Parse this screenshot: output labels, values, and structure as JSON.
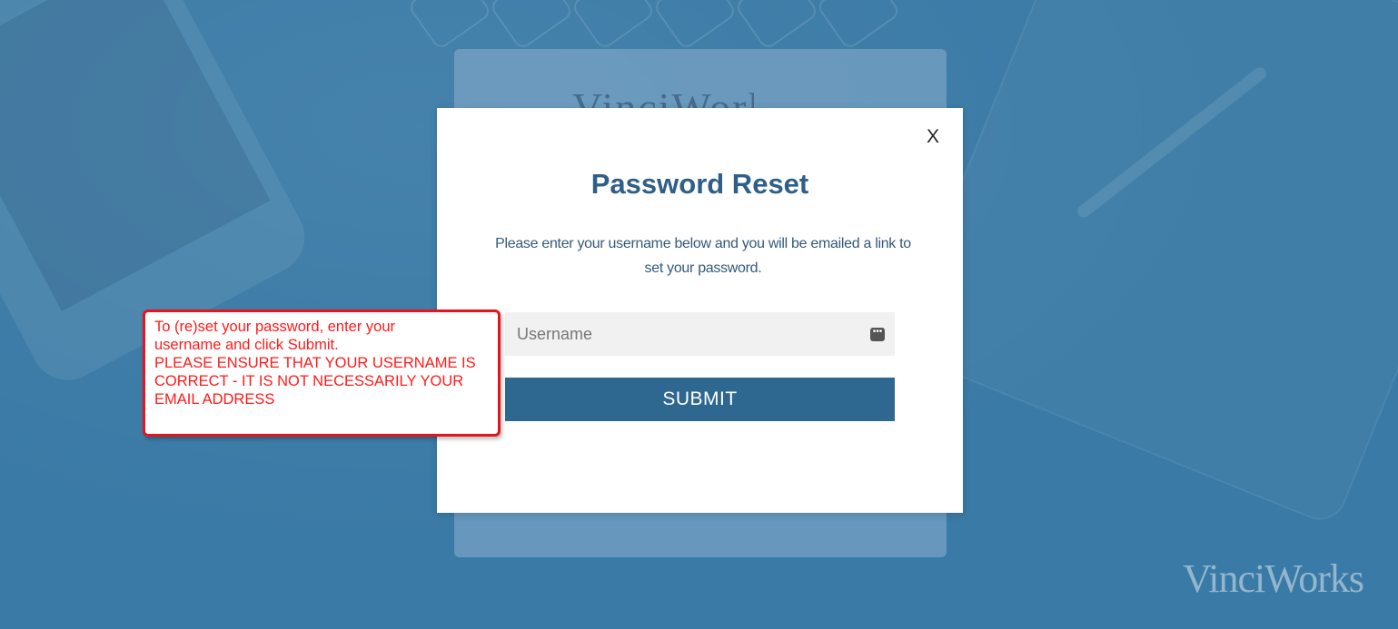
{
  "modal": {
    "close_label": "X",
    "title": "Password Reset",
    "description_line1": "Please enter your username below and you will be emailed a link to",
    "description_line2": "set your password.",
    "username_placeholder": "Username",
    "submit_label": "SUBMIT"
  },
  "callout": {
    "line1": "To (re)set your password, enter your",
    "line2": "username and click Submit.",
    "line3": "PLEASE ENSURE THAT YOUR USERNAME IS",
    "line4": "CORRECT - IT IS NOT NECESSARILY YOUR",
    "line5": "EMAIL ADDRESS",
    "border_color": "#e8141b",
    "text_color": "#ff1a1a"
  },
  "brand": {
    "logo_text": "VinciWorks"
  },
  "colors": {
    "background": "#3a7aa6",
    "title": "#2f5f87",
    "submit_bg": "#2e6891"
  }
}
